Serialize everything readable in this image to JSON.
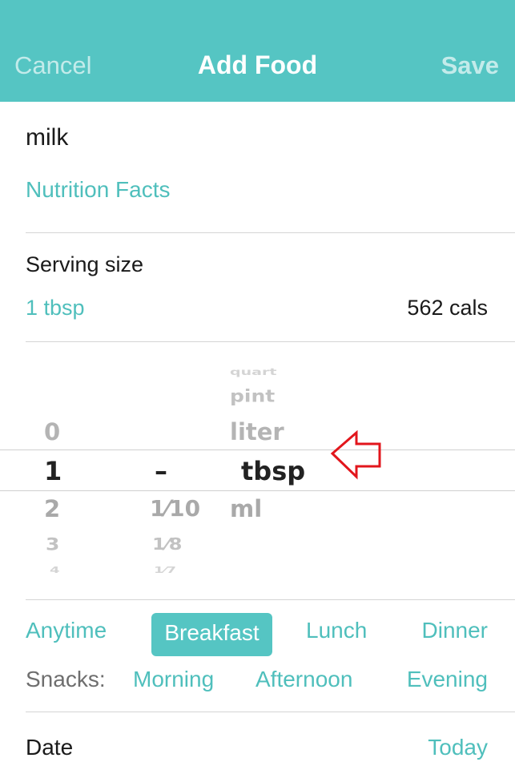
{
  "header": {
    "cancel_label": "Cancel",
    "title": "Add Food",
    "save_label": "Save"
  },
  "food": {
    "name": "milk",
    "nutrition_link": "Nutrition Facts"
  },
  "serving": {
    "label": "Serving size",
    "value": "1 tbsp",
    "calories": "562 cals"
  },
  "picker": {
    "whole": {
      "above": [
        "0"
      ],
      "selected": "1",
      "below": [
        "2",
        "3",
        "4"
      ]
    },
    "fraction": {
      "selected": "–",
      "below": [
        "1⁄10",
        "1⁄8",
        "1⁄7"
      ]
    },
    "unit": {
      "above": [
        "quart",
        "pint",
        "liter"
      ],
      "selected": "tbsp",
      "below": [
        "ml"
      ]
    }
  },
  "meals": {
    "options": [
      "Anytime",
      "Breakfast",
      "Lunch",
      "Dinner"
    ],
    "selected": "Breakfast",
    "snacks_label": "Snacks:",
    "snacks": [
      "Morning",
      "Afternoon",
      "Evening"
    ]
  },
  "date": {
    "label": "Date",
    "value": "Today"
  },
  "colors": {
    "accent": "#55c5c3",
    "link": "#4fbfbc",
    "annotation_arrow": "#e2161c"
  },
  "icons": {
    "annotation": "left-arrow-outline-icon"
  }
}
